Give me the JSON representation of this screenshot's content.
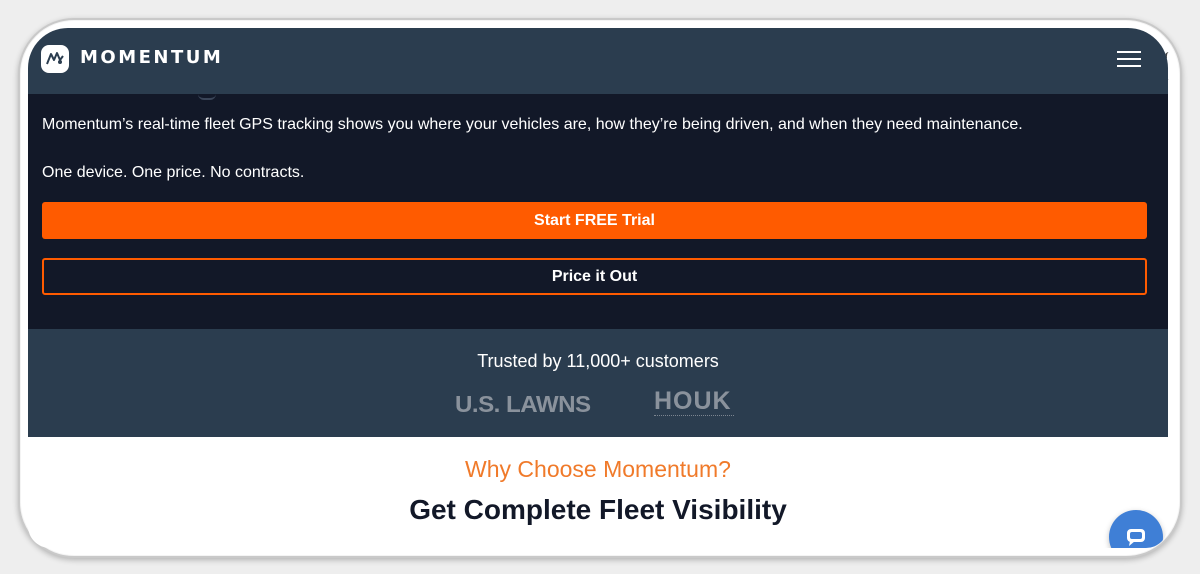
{
  "brand": {
    "name": "MOMENTUM"
  },
  "header": {
    "menu_icon": "hamburger-menu-icon"
  },
  "hero": {
    "description": "Momentum’s real-time fleet GPS tracking shows you where your vehicles are, how they’re being driven, and when they need maintenance.",
    "tagline": "One device. One price. No contracts.",
    "primary_cta": "Start FREE Trial",
    "secondary_cta": "Price it Out"
  },
  "trusted": {
    "text": "Trusted by 11,000+ customers",
    "logos": [
      {
        "name": "U.S. LAWNS"
      },
      {
        "name": "HOUK"
      }
    ]
  },
  "section": {
    "eyebrow": "Why Choose Momentum?",
    "title": "Get Complete Fleet Visibility"
  },
  "chat": {
    "icon": "chat-bubble-icon"
  },
  "colors": {
    "header_bg": "#2b3d4f",
    "hero_bg": "#121828",
    "accent_orange": "#ff5b00",
    "eyebrow_orange": "#f07a2a",
    "chat_blue": "#3f7fd6"
  }
}
